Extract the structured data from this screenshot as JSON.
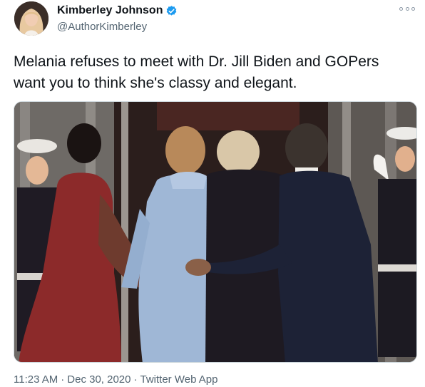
{
  "tweet": {
    "display_name": "Kimberley Johnson",
    "handle": "@AuthorKimberley",
    "verified": true,
    "text_line1": "Melania refuses to meet with Dr. Jill Biden and GOPers",
    "text_line2": "want you to think she's classy and elegant.",
    "time": "11:23 AM",
    "date": "Dec 30, 2020",
    "source": "Twitter Web App",
    "separator": "·"
  },
  "icons": {
    "verified": "verified-badge-icon",
    "more": "more-options-icon"
  },
  "colors": {
    "accent": "#1d9bf0",
    "secondary_text": "#536471",
    "primary_text": "#0f1419"
  }
}
